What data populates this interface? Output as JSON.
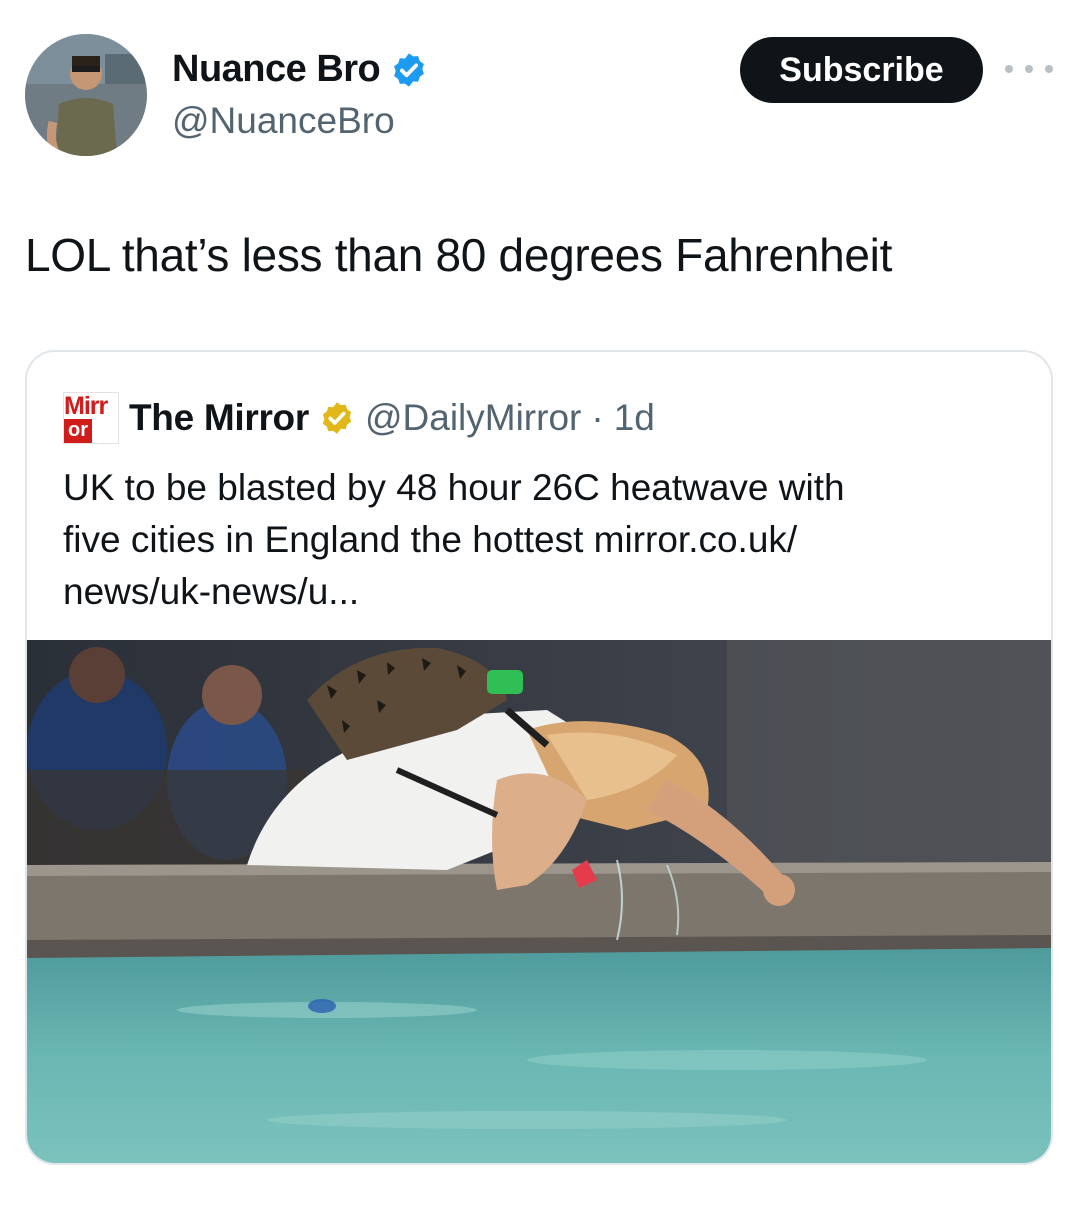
{
  "author": {
    "display_name": "Nuance Bro",
    "handle": "@NuanceBro",
    "verified_icon": "verified-badge-blue"
  },
  "actions": {
    "subscribe_label": "Subscribe",
    "more_icon": "more-horizontal-icon"
  },
  "tweet": {
    "text": "LOL that’s less than 80 degrees Fahrenheit"
  },
  "quote": {
    "logo": {
      "top": "Mirr",
      "bottom": "or"
    },
    "display_name": "The Mirror",
    "verified_icon": "verified-badge-gold",
    "handle": "@DailyMirror",
    "separator": "·",
    "time": "1d",
    "text_lines": [
      "UK to be blasted by 48 hour 26C heatwave with",
      "five cities in England the hottest mirror.co.uk/",
      "news/uk-news/u..."
    ]
  },
  "colors": {
    "subscribe_bg": "#0f1419",
    "verified_blue": "#1d9bf0",
    "verified_gold": "#e2b719",
    "secondary_text": "#536471",
    "mirror_red": "#d11c1c"
  }
}
